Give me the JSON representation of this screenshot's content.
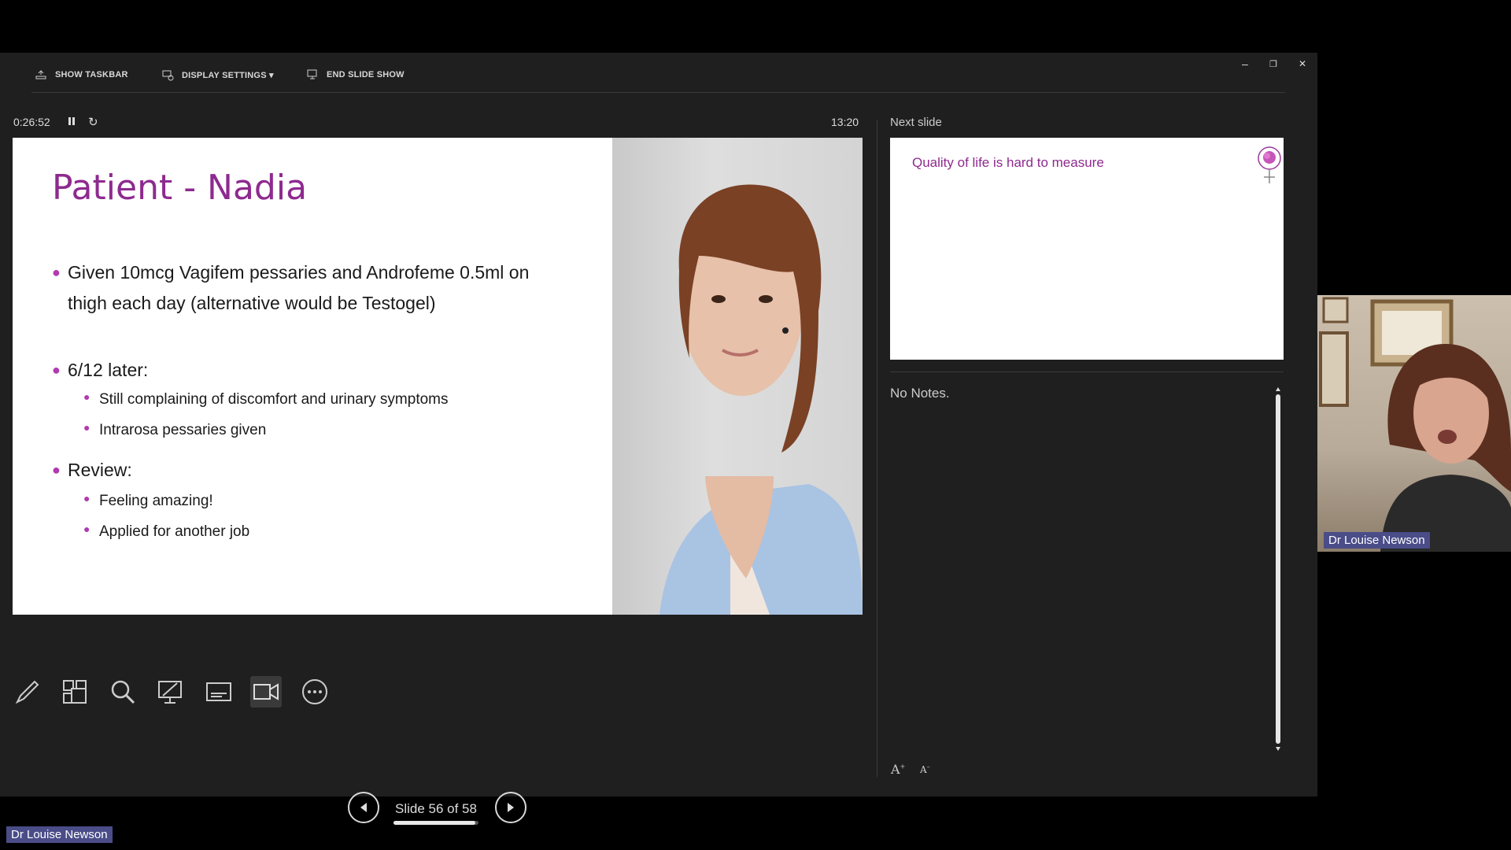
{
  "toolbar": {
    "show_taskbar": "SHOW TASKBAR",
    "display_settings": "DISPLAY SETTINGS ▾",
    "end_slide_show": "END SLIDE SHOW"
  },
  "window_controls": {
    "minimize": "–",
    "restore": "❐",
    "close": "✕"
  },
  "timer": {
    "elapsed": "0:26:52",
    "clock": "13:20",
    "pause_icon": "pause-icon",
    "reset_icon": "reset-icon"
  },
  "slide": {
    "title": "Patient - Nadia",
    "bullets": [
      {
        "text": "Given 10mcg Vagifem pessaries and Androfeme 0.5ml on thigh each day (alternative would be Testogel)",
        "sub": []
      },
      {
        "text": "6/12 later:",
        "sub": [
          "Still complaining of discomfort and urinary symptoms",
          "Intrarosa pessaries given"
        ]
      },
      {
        "text": "Review:",
        "sub": [
          "Feeling amazing!",
          "Applied for another job"
        ]
      }
    ]
  },
  "tools": [
    "pen-icon",
    "see-all-slides-icon",
    "zoom-icon",
    "pointer-screen-icon",
    "subtitles-icon",
    "camera-icon",
    "more-options-icon"
  ],
  "navigation": {
    "label": "Slide 56 of 58",
    "current": 56,
    "total": 58,
    "progress": 0.966
  },
  "next_slide": {
    "label": "Next slide",
    "title": "Quality of life is hard to measure"
  },
  "notes": {
    "text": "No Notes."
  },
  "font_size_controls": {
    "increase": "A",
    "decrease": "A"
  },
  "webcam": {
    "name": "Dr Louise Newson"
  },
  "speaker_label": "Dr Louise Newson",
  "colors": {
    "accent": "#8e2a8f",
    "bullet": "#b03bb0",
    "name_tag": "#4a4d88"
  }
}
